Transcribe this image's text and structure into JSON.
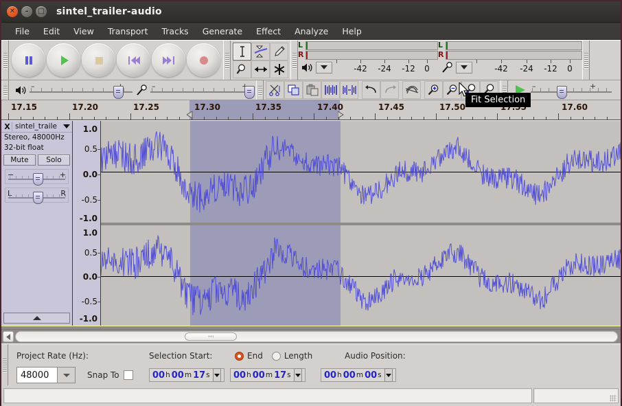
{
  "window": {
    "title": "sintel_trailer-audio",
    "buttons": {
      "close": "close-window",
      "minimize": "minimize-window",
      "maximize": "maximize-window"
    }
  },
  "menu": {
    "items": [
      "File",
      "Edit",
      "View",
      "Transport",
      "Tracks",
      "Generate",
      "Effect",
      "Analyze",
      "Help"
    ]
  },
  "transport": {
    "buttons": [
      {
        "name": "pause-button",
        "icon": "pause-icon"
      },
      {
        "name": "play-button",
        "icon": "play-icon"
      },
      {
        "name": "stop-button",
        "icon": "stop-icon"
      },
      {
        "name": "skip-to-start-button",
        "icon": "skip-start-icon"
      },
      {
        "name": "skip-to-end-button",
        "icon": "skip-end-icon"
      },
      {
        "name": "record-button",
        "icon": "record-icon"
      }
    ]
  },
  "tools": {
    "items": [
      {
        "name": "selection-tool",
        "icon": "i-beam-icon",
        "selected": true
      },
      {
        "name": "envelope-tool",
        "icon": "envelope-icon",
        "selected": false
      },
      {
        "name": "draw-tool",
        "icon": "pencil-icon",
        "selected": false
      },
      {
        "name": "zoom-tool",
        "icon": "magnifier-icon",
        "selected": false
      },
      {
        "name": "timeshift-tool",
        "icon": "double-arrow-icon",
        "selected": false
      },
      {
        "name": "multi-tool",
        "icon": "asterisk-icon",
        "selected": false
      }
    ]
  },
  "meters": {
    "output": {
      "name": "output-meter",
      "icon": "speaker-icon",
      "channels": [
        "L",
        "R"
      ],
      "scale": [
        "-42",
        "-24",
        "-12",
        "0"
      ]
    },
    "input": {
      "name": "input-meter",
      "icon": "microphone-icon",
      "channels": [
        "L",
        "R"
      ],
      "scale": [
        "-42",
        "-24",
        "-12",
        "0"
      ]
    }
  },
  "mixer": {
    "output_volume": {
      "name": "output-volume-slider",
      "icon": "speaker-icon",
      "value": 92
    },
    "input_volume": {
      "name": "input-volume-slider",
      "icon": "microphone-icon",
      "value": 100
    }
  },
  "edit_toolbar": {
    "buttons": [
      {
        "name": "cut-button",
        "icon": "scissors-icon"
      },
      {
        "name": "copy-button",
        "icon": "copy-icon"
      },
      {
        "name": "paste-button",
        "icon": "paste-icon"
      },
      {
        "name": "trim-outside-selection-button",
        "icon": "trim-icon"
      },
      {
        "name": "silence-selection-button",
        "icon": "silence-icon"
      },
      {
        "name": "undo-button",
        "icon": "undo-icon"
      },
      {
        "name": "redo-button",
        "icon": "redo-icon"
      },
      {
        "name": "sync-lock-button",
        "icon": "sync-lock-icon"
      },
      {
        "name": "zoom-in-button",
        "icon": "zoom-in-icon"
      },
      {
        "name": "zoom-out-button",
        "icon": "zoom-out-icon"
      },
      {
        "name": "fit-selection-button",
        "icon": "fit-selection-icon"
      },
      {
        "name": "fit-project-button",
        "icon": "fit-project-icon"
      }
    ]
  },
  "play_at_speed": {
    "name": "play-at-speed-button",
    "icon": "play-icon",
    "slider": {
      "name": "playback-speed-slider",
      "value": 33
    }
  },
  "tooltip": {
    "text": "Fit Selection"
  },
  "ruler": {
    "labels": [
      "17.15",
      "17.20",
      "17.25",
      "17.30",
      "17.35",
      "17.40",
      "17.45",
      "17.50",
      "17.55",
      "17.60"
    ],
    "selection_start_label": "17.30",
    "selection_end_label": "17.40"
  },
  "track": {
    "name": "sintel_traile",
    "format_line1": "Stereo, 48000Hz",
    "format_line2": "32-bit float",
    "mute_label": "Mute",
    "solo_label": "Solo",
    "close_label": "X",
    "gain_slider": {
      "name": "gain-slider",
      "min_label": "−",
      "max_label": "+",
      "value": 50
    },
    "pan_slider": {
      "name": "pan-slider",
      "left_label": "L",
      "right_label": "R",
      "value": 50
    },
    "vertical_ruler_labels": [
      "1.0",
      "0.5",
      "0.0",
      "-0.5",
      "-1.0"
    ]
  },
  "selection_bar": {
    "project_rate_label": "Project Rate (Hz):",
    "project_rate_value": "48000",
    "snap_to_label": "Snap To",
    "snap_to_checked": false,
    "selection_start_label": "Selection Start:",
    "end_label": "End",
    "length_label": "Length",
    "end_selected": true,
    "audio_position_label": "Audio Position:",
    "fields": [
      {
        "name": "selection-start-field",
        "hours": "00",
        "h": "h",
        "minutes": "00",
        "m": "m",
        "seconds": "17",
        "s": "s"
      },
      {
        "name": "selection-end-field",
        "hours": "00",
        "h": "h",
        "minutes": "00",
        "m": "m",
        "seconds": "17",
        "s": "s"
      },
      {
        "name": "audio-position-field",
        "hours": "00",
        "h": "h",
        "minutes": "00",
        "m": "m",
        "seconds": "00",
        "s": "s"
      }
    ]
  },
  "colors": {
    "waveform": "#4a47d8",
    "track_background": "#c3c0bd",
    "selection_background": "#9d9cb8",
    "panel": "#c8c6d8",
    "toolbar": "#d4d0ce",
    "titlebar": "#3c3b37",
    "accent": "#d8521d"
  }
}
